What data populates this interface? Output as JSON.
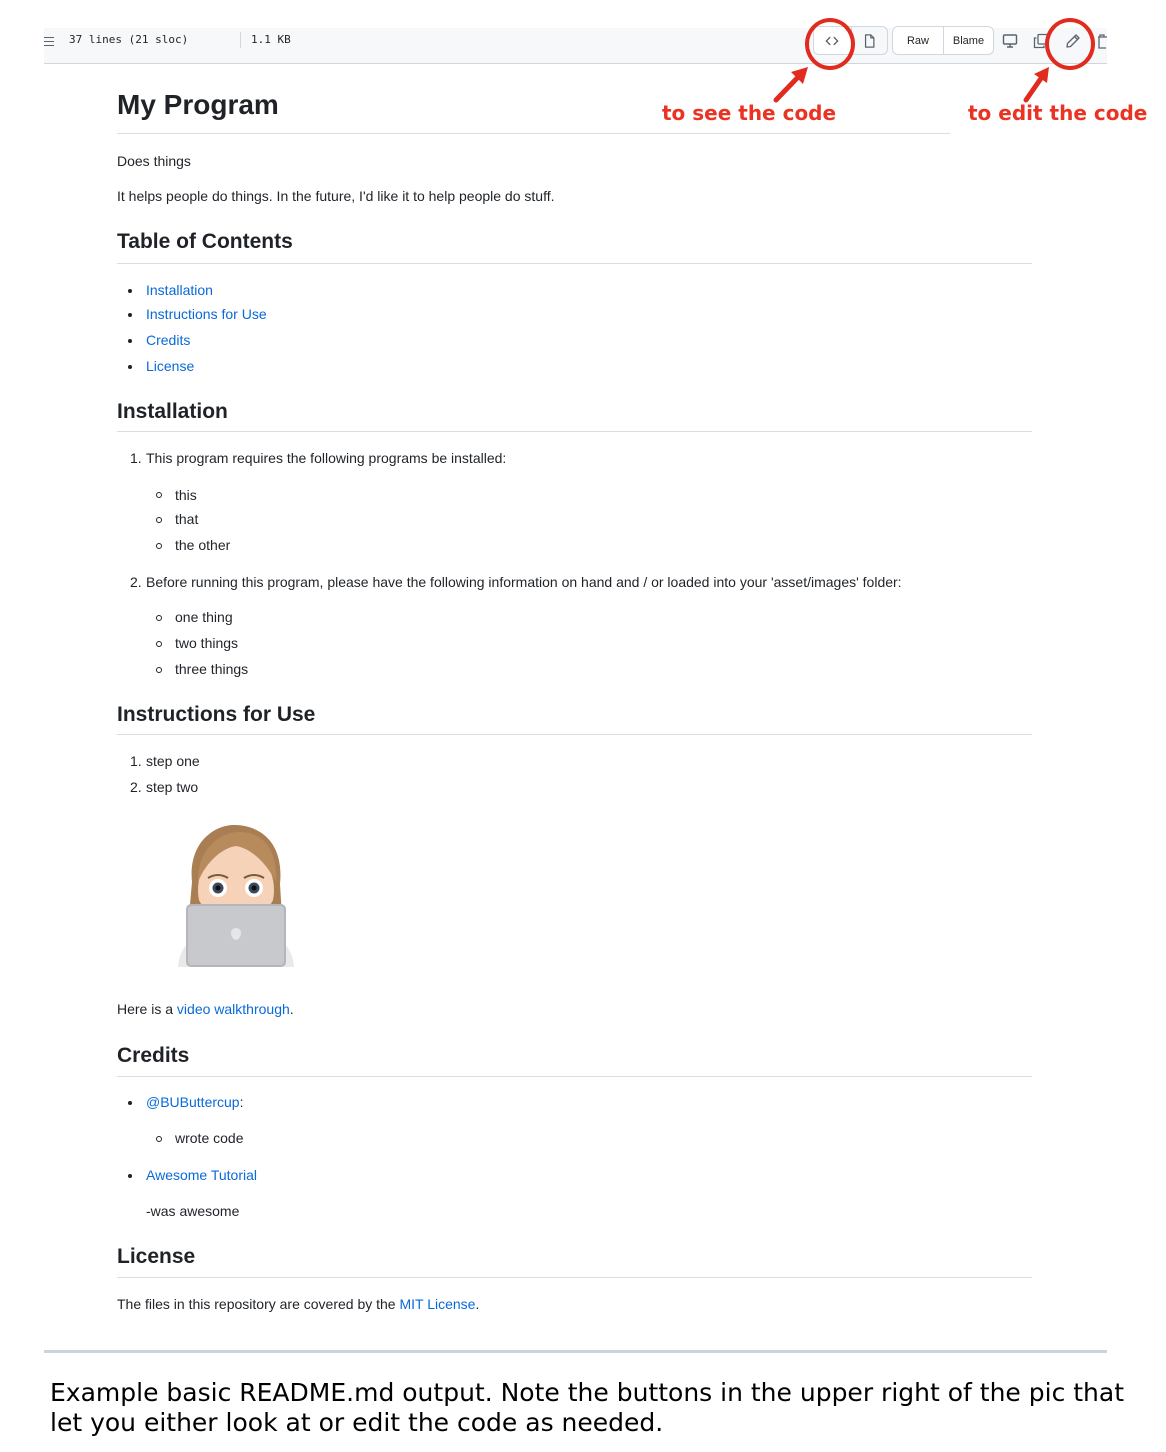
{
  "file_header": {
    "lines_info": "37 lines (21 sloc)",
    "size": "1.1 KB",
    "raw_label": "Raw",
    "blame_label": "Blame",
    "code_icon": "code-icon",
    "preview_icon": "file-icon",
    "desktop_icon": "desktop-icon",
    "copy_icon": "copy-icon",
    "edit_icon": "pencil-icon",
    "delete_icon": "trash-icon"
  },
  "annotations": {
    "see_code": "to see the code",
    "edit_code": "to edit the code",
    "color": "#e12b1f"
  },
  "readme": {
    "title": "My Program",
    "tagline": "Does things",
    "description": "It helps people do things. In the future, I'd like it to help people do stuff.",
    "toc": {
      "heading": "Table of Contents",
      "items": [
        "Installation",
        "Instructions for Use",
        "Credits",
        "License"
      ]
    },
    "installation": {
      "heading": "Installation",
      "step1": "This program requires the following programs be installed:",
      "step1_items": [
        "this",
        "that",
        "the other"
      ],
      "step2": "Before running this program, please have the following information on hand and / or loaded into your 'asset/images' folder:",
      "step2_items": [
        "one thing",
        "two things",
        "three things"
      ]
    },
    "usage": {
      "heading": "Instructions for Use",
      "steps": [
        "step one",
        "step two"
      ],
      "image_alt": "memoji-laptop",
      "video_prefix": "Here is a ",
      "video_link": "video walkthrough",
      "video_suffix": "."
    },
    "credits": {
      "heading": "Credits",
      "person": "@BUButtercup",
      "person_suffix": ":",
      "person_note": "wrote code",
      "tutorial": "Awesome Tutorial",
      "tutorial_note": "-was awesome"
    },
    "license": {
      "heading": "License",
      "prefix": "The files in this repository are covered by the ",
      "link": "MIT License",
      "suffix": "."
    },
    "link_color": "#0969da"
  },
  "caption": "Example basic README.md output. Note the buttons in the upper right of the pic that let you either look at or edit the code as needed."
}
